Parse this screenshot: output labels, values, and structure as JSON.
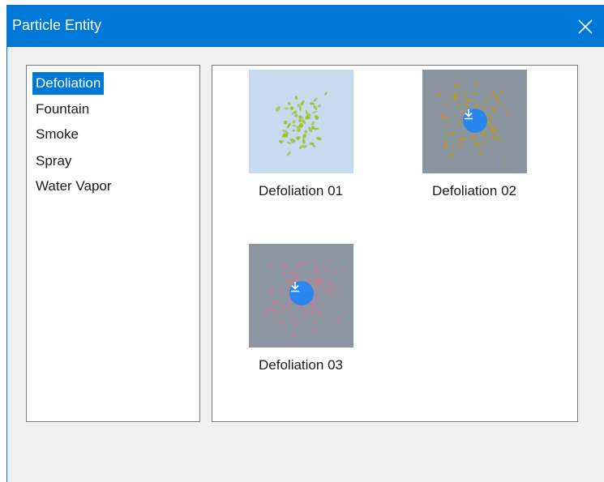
{
  "window": {
    "title": "Particle Entity",
    "close_icon": "close-icon"
  },
  "categories": {
    "items": [
      {
        "label": "Defoliation",
        "selected": true
      },
      {
        "label": "Fountain",
        "selected": false
      },
      {
        "label": "Smoke",
        "selected": false
      },
      {
        "label": "Spray",
        "selected": false
      },
      {
        "label": "Water Vapor",
        "selected": false
      }
    ]
  },
  "gallery": {
    "items": [
      {
        "label": "Defoliation 01",
        "downloaded": true,
        "preview_bg": "#c6daf0",
        "particle_color": "#9ec12a"
      },
      {
        "label": "Defoliation 02",
        "downloaded": false,
        "preview_bg": "#8a95a0",
        "particle_color": "#b79a2a",
        "icon": "download-icon"
      },
      {
        "label": "Defoliation 03",
        "downloaded": false,
        "preview_bg": "#8e97a1",
        "particle_color": "#c77e97",
        "icon": "download-icon"
      }
    ]
  },
  "colors": {
    "accent": "#0078d7",
    "download_badge": "#2b87f0"
  }
}
